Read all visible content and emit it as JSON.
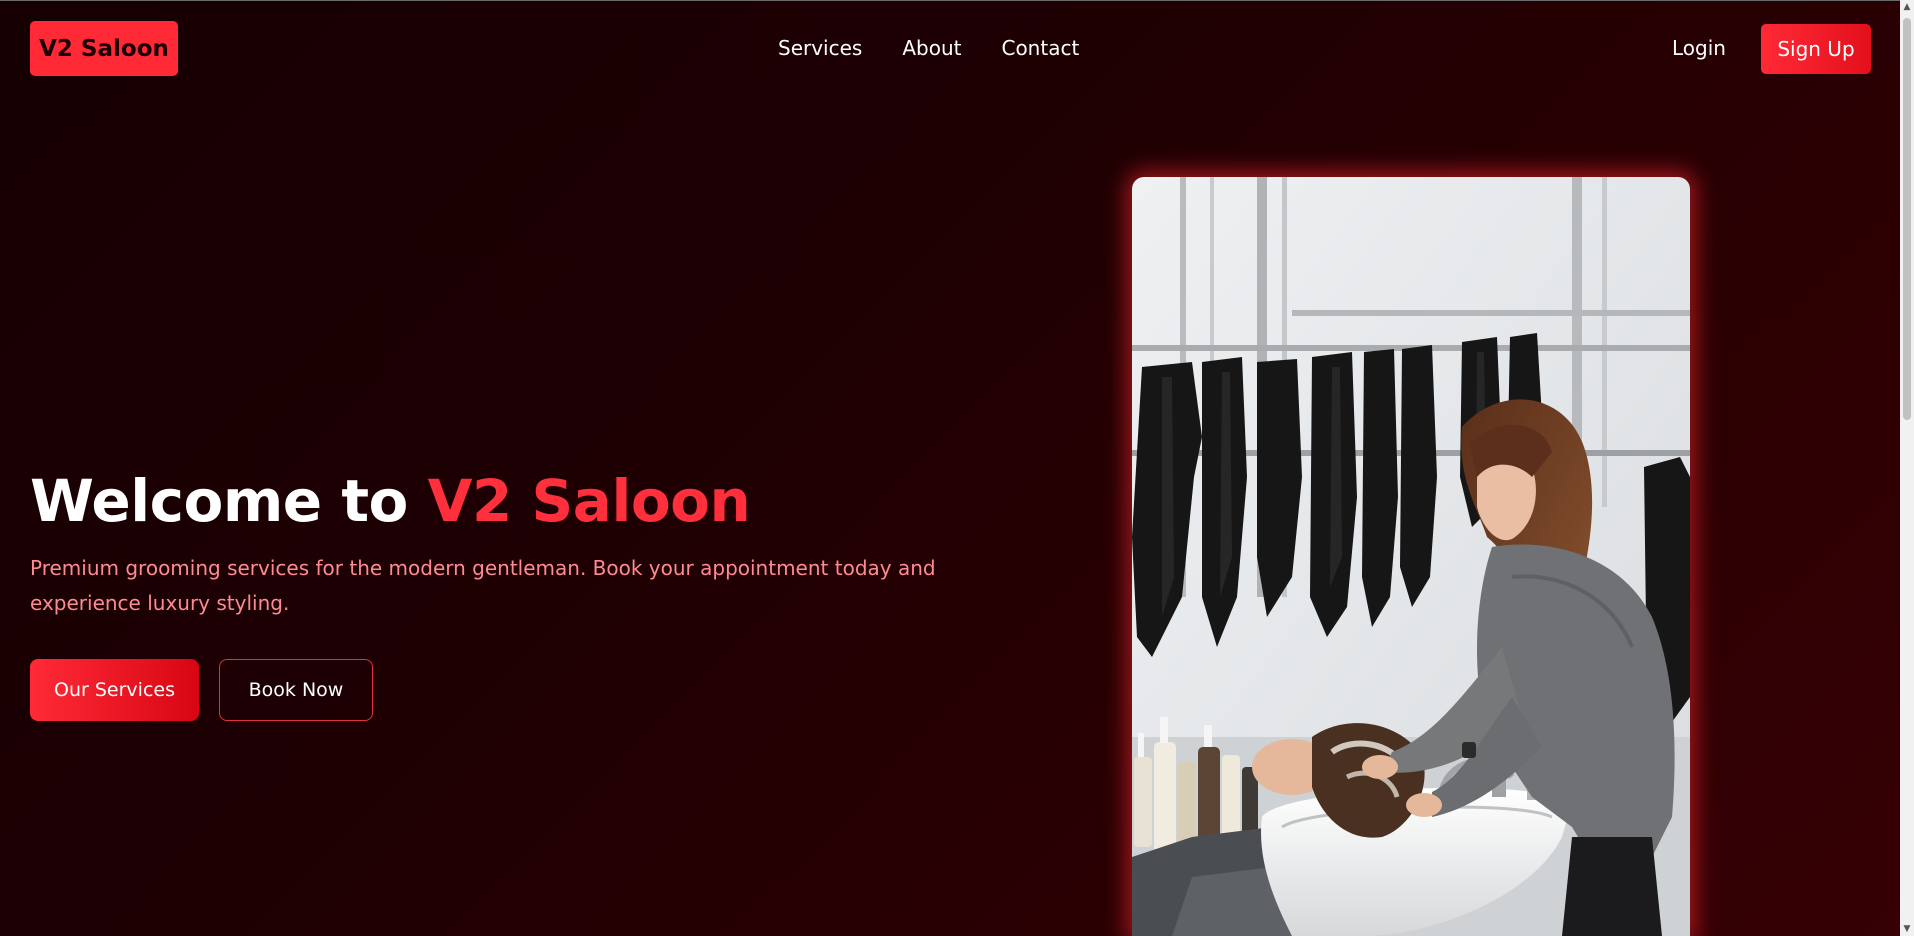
{
  "header": {
    "logo": "V2 Saloon",
    "nav": [
      "Services",
      "About",
      "Contact"
    ],
    "login": "Login",
    "signup": "Sign Up"
  },
  "hero": {
    "title_prefix": "Welcome to ",
    "title_accent": "V2 Saloon",
    "subtitle": "Premium grooming services for the modern gentleman. Book your appointment today and experience luxury styling.",
    "primary_button": "Our Services",
    "secondary_button": "Book Now"
  },
  "colors": {
    "accent": "#ff2a36",
    "background_dark": "#1a0003",
    "subtitle": "#ff8a92"
  }
}
